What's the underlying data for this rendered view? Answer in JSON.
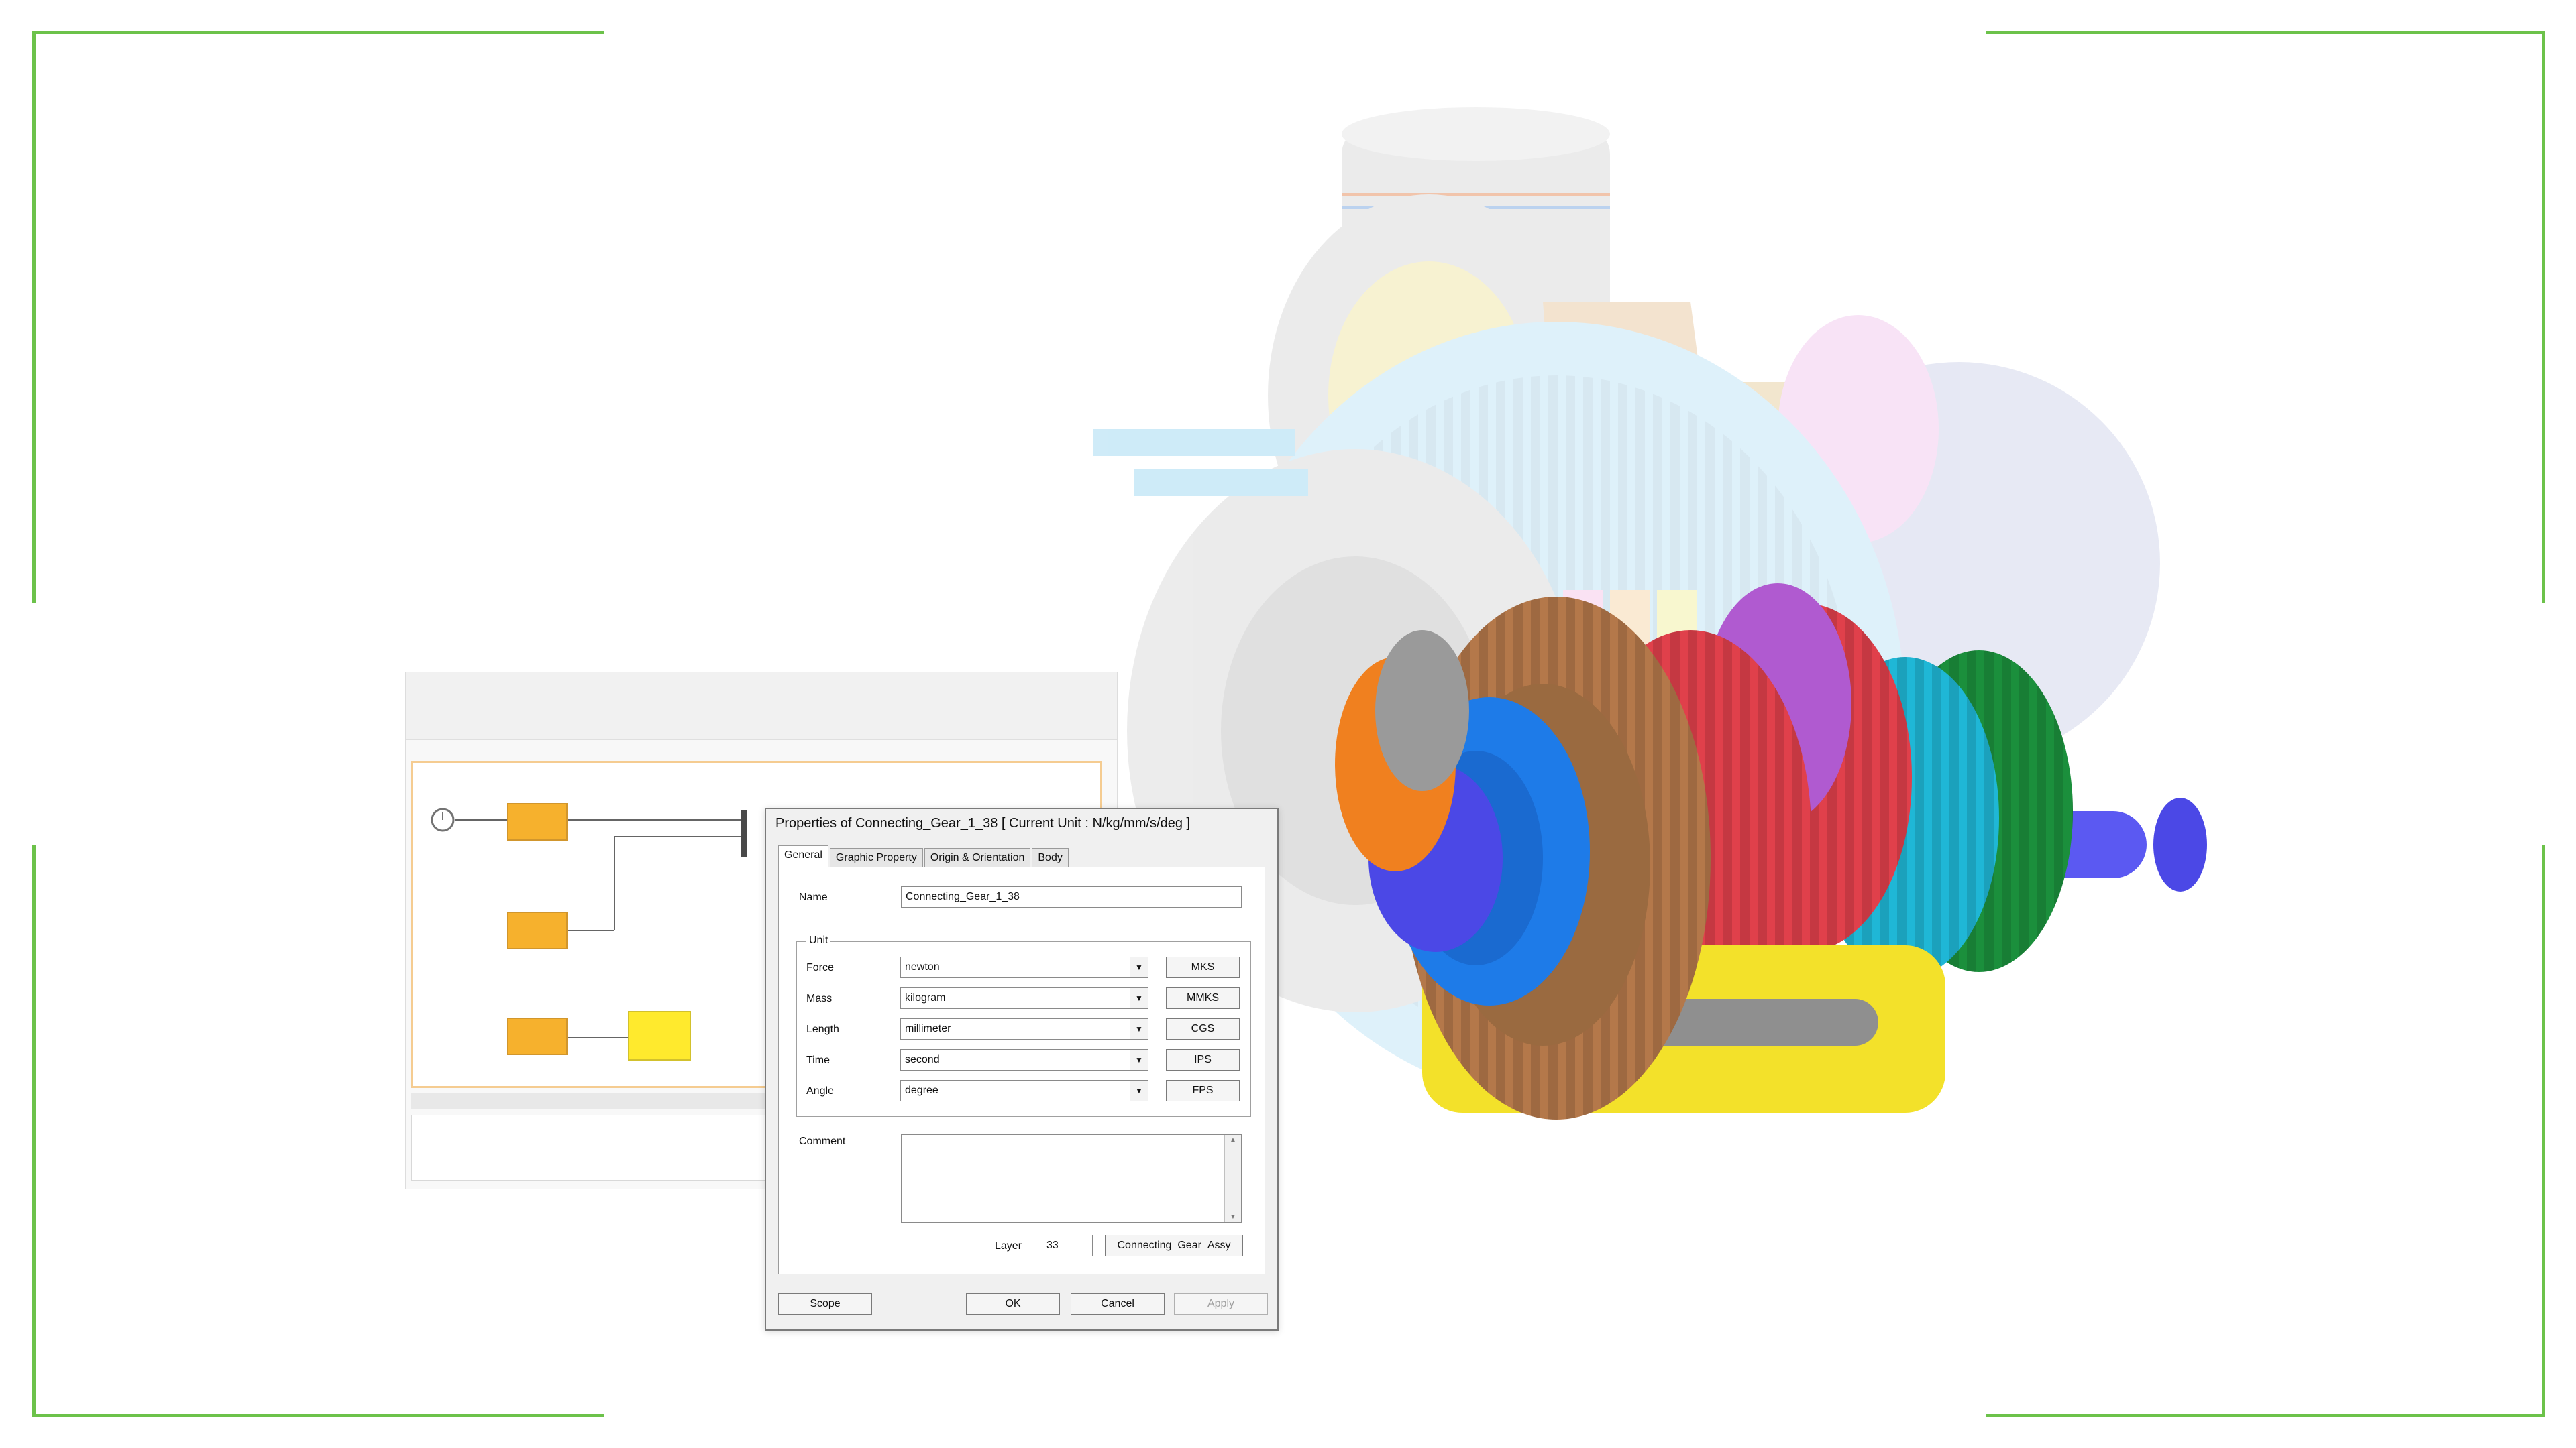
{
  "dialog": {
    "title": "Properties of Connecting_Gear_1_38 [ Current Unit : N/kg/mm/s/deg ]",
    "tabs": [
      "General",
      "Graphic Property",
      "Origin & Orientation",
      "Body"
    ],
    "active_tab": "General",
    "name_label": "Name",
    "name_value": "Connecting_Gear_1_38",
    "unit_group_label": "Unit",
    "units": [
      {
        "label": "Force",
        "value": "newton",
        "preset": "MKS"
      },
      {
        "label": "Mass",
        "value": "kilogram",
        "preset": "MMKS"
      },
      {
        "label": "Length",
        "value": "millimeter",
        "preset": "CGS"
      },
      {
        "label": "Time",
        "value": "second",
        "preset": "IPS"
      },
      {
        "label": "Angle",
        "value": "degree",
        "preset": "FPS"
      }
    ],
    "comment_label": "Comment",
    "comment_value": "",
    "layer_label": "Layer",
    "layer_value": "33",
    "layer_button": "Connecting_Gear_Assy",
    "buttons": {
      "scope": "Scope",
      "ok": "OK",
      "cancel": "Cancel",
      "apply": "Apply"
    }
  },
  "colors": {
    "frame_border": "#6cc24a",
    "block_orange": "#f5a000",
    "block_yellow": "#ffe600"
  },
  "icons": [
    "clock-icon",
    "dropdown-arrow-icon",
    "scroll-up-icon",
    "scroll-down-icon"
  ]
}
